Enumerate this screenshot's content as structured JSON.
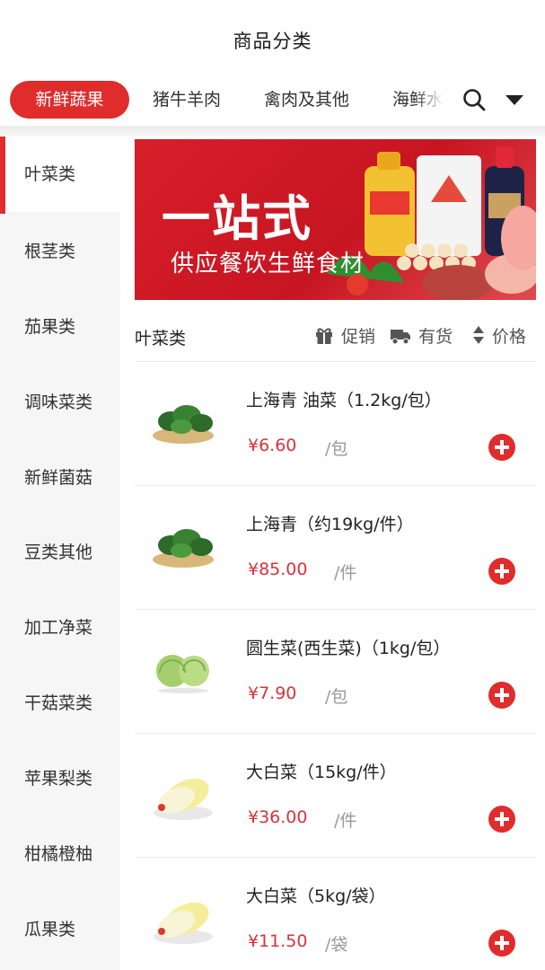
{
  "header": {
    "title": "商品分类"
  },
  "tabs": [
    {
      "label": "新鲜蔬果",
      "active": true
    },
    {
      "label": "猪牛羊肉",
      "active": false
    },
    {
      "label": "禽肉及其他",
      "active": false
    },
    {
      "label": "海鲜水",
      "active": false
    }
  ],
  "icons": {
    "search": "search-icon",
    "dropdown": "caret-down-icon"
  },
  "sidebar": [
    {
      "label": "叶菜类",
      "active": true
    },
    {
      "label": "根茎类",
      "active": false
    },
    {
      "label": "茄果类",
      "active": false
    },
    {
      "label": "调味菜类",
      "active": false
    },
    {
      "label": "新鲜菌菇",
      "active": false
    },
    {
      "label": "豆类其他",
      "active": false
    },
    {
      "label": "加工净菜",
      "active": false
    },
    {
      "label": "干菇菜类",
      "active": false
    },
    {
      "label": "苹果梨类",
      "active": false
    },
    {
      "label": "柑橘橙柚",
      "active": false
    },
    {
      "label": "瓜果类",
      "active": false
    }
  ],
  "banner": {
    "title": "一站式",
    "subtitle": "供应餐饮生鲜食材"
  },
  "section": {
    "title": "叶菜类",
    "filters": {
      "promo": "促销",
      "stock": "有货",
      "price": "价格"
    }
  },
  "products": [
    {
      "name": "上海青 油菜（1.2kg/包）",
      "price": "¥6.60",
      "unit": "/包",
      "image": "greens"
    },
    {
      "name": "上海青（约19kg/件）",
      "price": "¥85.00",
      "unit": "/件",
      "image": "greens"
    },
    {
      "name": "圆生菜(西生菜)（1kg/包）",
      "price": "¥7.90",
      "unit": "/包",
      "image": "lettuce"
    },
    {
      "name": "大白菜（15kg/件）",
      "price": "¥36.00",
      "unit": "/件",
      "image": "cabbage"
    },
    {
      "name": "大白菜（5kg/袋）",
      "price": "¥11.50",
      "unit": "/袋",
      "image": "cabbage"
    }
  ],
  "colors": {
    "accent": "#e02c2c",
    "price": "#d9323a",
    "sidebar_bg": "#f6f6f6"
  }
}
